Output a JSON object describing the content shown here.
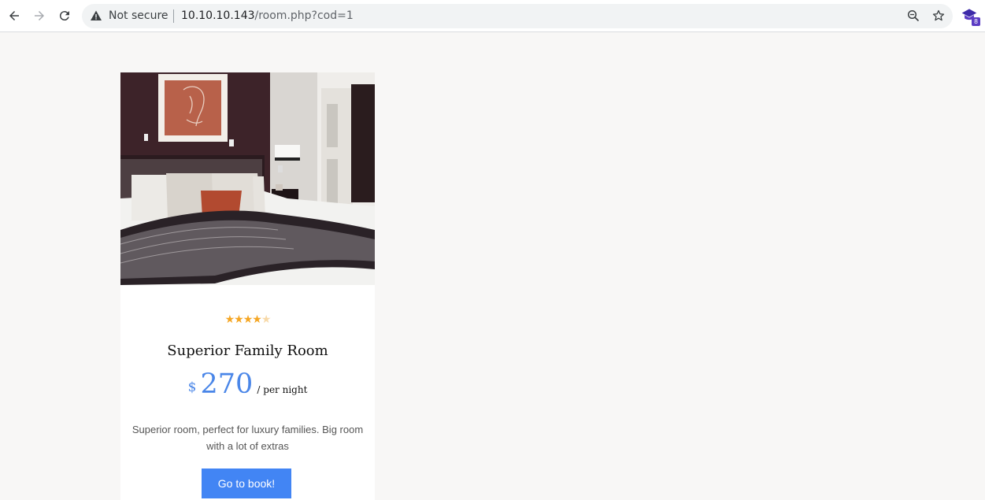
{
  "browser": {
    "security_label": "Not secure",
    "url_host": "10.10.10.143",
    "url_path": "/room.php?cod=1",
    "extension_badge": "8"
  },
  "room": {
    "image": "hotel-bedroom-photo",
    "rating": 4,
    "rating_max": 5,
    "stars": {
      "filled": "★★★★",
      "empty": "★"
    },
    "title": "Superior Family Room",
    "currency": "$",
    "price": "270",
    "price_unit": "/ per night",
    "description": "Superior room, perfect for luxury families. Big room with a lot of extras",
    "button_label": "Go to book!"
  },
  "colors": {
    "accent": "#4285f4",
    "price": "#4a86e8",
    "star": "#f5a623"
  }
}
